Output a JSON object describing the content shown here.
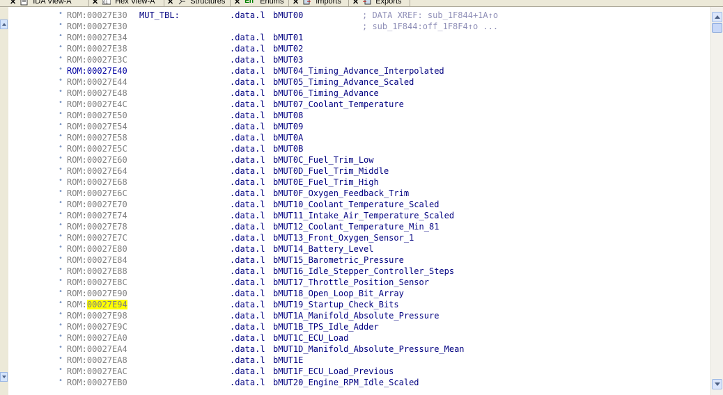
{
  "tabs": [
    {
      "label": "IDA View-A",
      "icon": "document-icon"
    },
    {
      "label": "Hex View-A",
      "icon": "hex-icon"
    },
    {
      "label": "Structures",
      "icon": "structures-icon"
    },
    {
      "label": "Enums",
      "icon": "enums-icon"
    },
    {
      "label": "Imports",
      "icon": "imports-icon"
    },
    {
      "label": "Exports",
      "icon": "exports-icon"
    }
  ],
  "listing": {
    "rows": [
      {
        "seg": "ROM:",
        "off": "00027E30",
        "label": "MUT_TBL:",
        "dir": ".data.l",
        "op": "bMUT00",
        "cmt": "; DATA XREF: sub_1F844+1A↑o"
      },
      {
        "seg": "ROM:",
        "off": "00027E30",
        "label": "",
        "dir": "",
        "op": "",
        "cmt": "; sub_1F844:off_1F8F4↑o ..."
      },
      {
        "seg": "ROM:",
        "off": "00027E34",
        "label": "",
        "dir": ".data.l",
        "op": "bMUT01",
        "cmt": ""
      },
      {
        "seg": "ROM:",
        "off": "00027E38",
        "label": "",
        "dir": ".data.l",
        "op": "bMUT02",
        "cmt": ""
      },
      {
        "seg": "ROM:",
        "off": "00027E3C",
        "label": "",
        "dir": ".data.l",
        "op": "bMUT03",
        "cmt": ""
      },
      {
        "seg": "ROM:",
        "off": "00027E40",
        "label": "",
        "dir": ".data.l",
        "op": "bMUT04_Timing_Advance_Interpolated",
        "cmt": ""
      },
      {
        "seg": "ROM:",
        "off": "00027E44",
        "label": "",
        "dir": ".data.l",
        "op": "bMUT05_Timing_Advance_Scaled",
        "cmt": ""
      },
      {
        "seg": "ROM:",
        "off": "00027E48",
        "label": "",
        "dir": ".data.l",
        "op": "bMUT06_Timing_Advance",
        "cmt": ""
      },
      {
        "seg": "ROM:",
        "off": "00027E4C",
        "label": "",
        "dir": ".data.l",
        "op": "bMUT07_Coolant_Temperature",
        "cmt": ""
      },
      {
        "seg": "ROM:",
        "off": "00027E50",
        "label": "",
        "dir": ".data.l",
        "op": "bMUT08",
        "cmt": ""
      },
      {
        "seg": "ROM:",
        "off": "00027E54",
        "label": "",
        "dir": ".data.l",
        "op": "bMUT09",
        "cmt": ""
      },
      {
        "seg": "ROM:",
        "off": "00027E58",
        "label": "",
        "dir": ".data.l",
        "op": "bMUT0A",
        "cmt": ""
      },
      {
        "seg": "ROM:",
        "off": "00027E5C",
        "label": "",
        "dir": ".data.l",
        "op": "bMUT0B",
        "cmt": ""
      },
      {
        "seg": "ROM:",
        "off": "00027E60",
        "label": "",
        "dir": ".data.l",
        "op": "bMUT0C_Fuel_Trim_Low",
        "cmt": ""
      },
      {
        "seg": "ROM:",
        "off": "00027E64",
        "label": "",
        "dir": ".data.l",
        "op": "bMUT0D_Fuel_Trim_Middle",
        "cmt": ""
      },
      {
        "seg": "ROM:",
        "off": "00027E68",
        "label": "",
        "dir": ".data.l",
        "op": "bMUT0E_Fuel_Trim_High",
        "cmt": ""
      },
      {
        "seg": "ROM:",
        "off": "00027E6C",
        "label": "",
        "dir": ".data.l",
        "op": "bMUT0F_Oxygen_Feedback_Trim",
        "cmt": ""
      },
      {
        "seg": "ROM:",
        "off": "00027E70",
        "label": "",
        "dir": ".data.l",
        "op": "bMUT10_Coolant_Temperature_Scaled",
        "cmt": ""
      },
      {
        "seg": "ROM:",
        "off": "00027E74",
        "label": "",
        "dir": ".data.l",
        "op": "bMUT11_Intake_Air_Temperature_Scaled",
        "cmt": ""
      },
      {
        "seg": "ROM:",
        "off": "00027E78",
        "label": "",
        "dir": ".data.l",
        "op": "bMUT12_Coolant_Temperature_Min_81",
        "cmt": ""
      },
      {
        "seg": "ROM:",
        "off": "00027E7C",
        "label": "",
        "dir": ".data.l",
        "op": "bMUT13_Front_Oxygen_Sensor_1",
        "cmt": ""
      },
      {
        "seg": "ROM:",
        "off": "00027E80",
        "label": "",
        "dir": ".data.l",
        "op": "bMUT14_Battery_Level",
        "cmt": ""
      },
      {
        "seg": "ROM:",
        "off": "00027E84",
        "label": "",
        "dir": ".data.l",
        "op": "bMUT15_Barometric_Pressure",
        "cmt": ""
      },
      {
        "seg": "ROM:",
        "off": "00027E88",
        "label": "",
        "dir": ".data.l",
        "op": "bMUT16_Idle_Stepper_Controller_Steps",
        "cmt": ""
      },
      {
        "seg": "ROM:",
        "off": "00027E8C",
        "label": "",
        "dir": ".data.l",
        "op": "bMUT17_Throttle_Position_Sensor",
        "cmt": ""
      },
      {
        "seg": "ROM:",
        "off": "00027E90",
        "label": "",
        "dir": ".data.l",
        "op": "bMUT18_Open_Loop_Bit_Array",
        "cmt": ""
      },
      {
        "seg": "ROM:",
        "off": "00027E94",
        "label": "",
        "dir": ".data.l",
        "op": "bMUT19_Startup_Check_Bits",
        "cmt": ""
      },
      {
        "seg": "ROM:",
        "off": "00027E98",
        "label": "",
        "dir": ".data.l",
        "op": "bMUT1A_Manifold_Absolute_Pressure",
        "cmt": ""
      },
      {
        "seg": "ROM:",
        "off": "00027E9C",
        "label": "",
        "dir": ".data.l",
        "op": "bMUT1B_TPS_Idle_Adder",
        "cmt": ""
      },
      {
        "seg": "ROM:",
        "off": "00027EA0",
        "label": "",
        "dir": ".data.l",
        "op": "bMUT1C_ECU_Load",
        "cmt": ""
      },
      {
        "seg": "ROM:",
        "off": "00027EA4",
        "label": "",
        "dir": ".data.l",
        "op": "bMUT1D_Manifold_Absolute_Pressure_Mean",
        "cmt": ""
      },
      {
        "seg": "ROM:",
        "off": "00027EA8",
        "label": "",
        "dir": ".data.l",
        "op": "bMUT1E",
        "cmt": ""
      },
      {
        "seg": "ROM:",
        "off": "00027EAC",
        "label": "",
        "dir": ".data.l",
        "op": "bMUT1F_ECU_Load_Previous",
        "cmt": ""
      },
      {
        "seg": "ROM:",
        "off": "00027EB0",
        "label": "",
        "dir": ".data.l",
        "op": "bMUT20_Engine_RPM_Idle_Scaled",
        "cmt": ""
      }
    ],
    "highlighted_address": "00027E94",
    "current_address": "00027E40"
  },
  "colors": {
    "address": "#808080",
    "code": "#000080",
    "comment": "#9090b8",
    "highlight": "#ffff00"
  }
}
